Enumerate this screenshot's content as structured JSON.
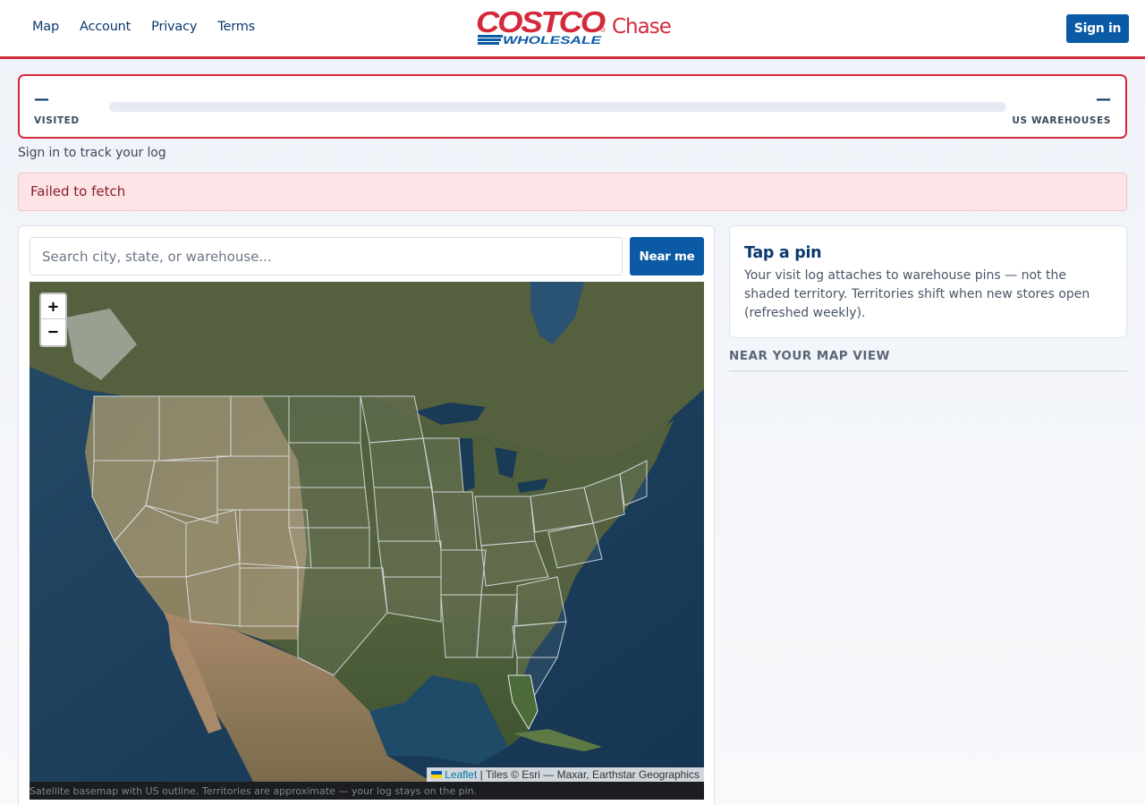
{
  "nav": {
    "items": [
      {
        "label": "Map"
      },
      {
        "label": "Account"
      },
      {
        "label": "Privacy"
      },
      {
        "label": "Terms"
      }
    ]
  },
  "brand": {
    "costco": "COSTCO",
    "wholesale": "WHOLESALE",
    "product": "Chase",
    "colors": {
      "red": "#d4293a",
      "blue": "#0a5aa6"
    }
  },
  "header": {
    "signin_label": "Sign in"
  },
  "progress": {
    "visited_value": "—",
    "visited_label": "VISITED",
    "total_value": "—",
    "total_label": "US WAREHOUSES",
    "fraction": 0
  },
  "signin_hint": "Sign in to track your log",
  "error": {
    "message": "Failed to fetch"
  },
  "search": {
    "placeholder": "Search city, state, or warehouse...",
    "near_me_label": "Near me"
  },
  "map": {
    "zoom_in": "+",
    "zoom_out": "−",
    "attribution_link": "Leaflet",
    "attribution_text": "| Tiles © Esri — Maxar, Earthstar Geographics",
    "caption": "Satellite basemap with US outline. Territories are approximate — your log stays on the pin."
  },
  "info": {
    "title": "Tap a pin",
    "body": "Your visit log attaches to warehouse pins — not the shaded territory. Territories shift when new stores open (refreshed weekly)."
  },
  "near_heading": "NEAR YOUR MAP VIEW"
}
